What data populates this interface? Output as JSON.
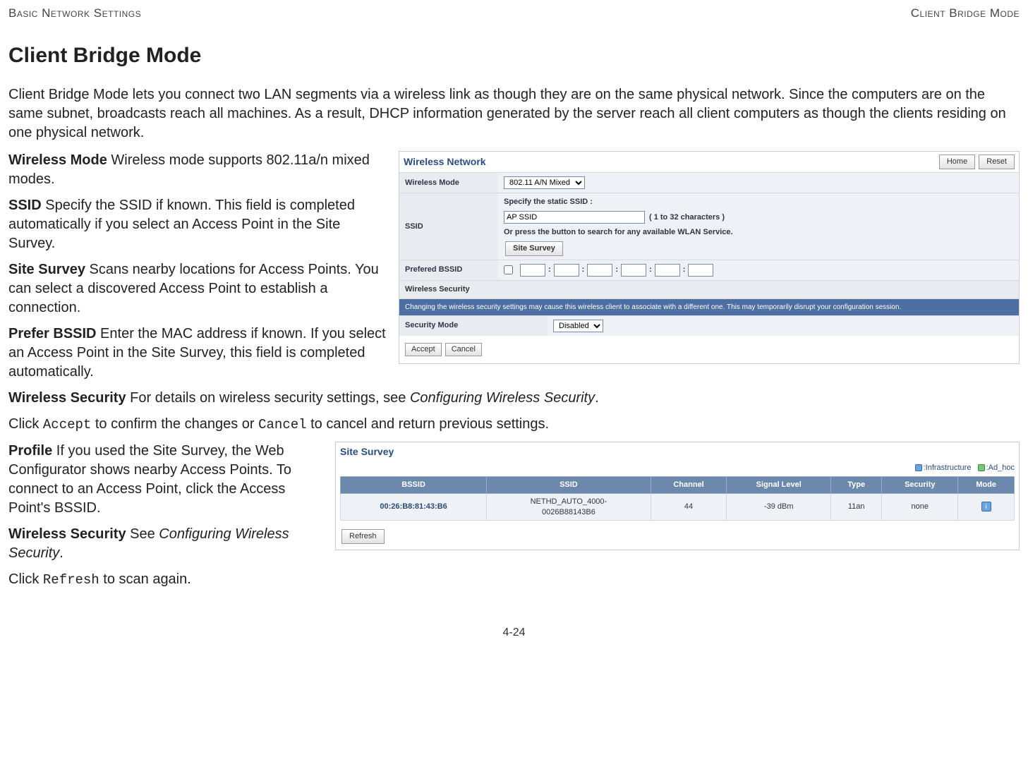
{
  "header": {
    "left": "Basic Network Settings",
    "right": "Client Bridge Mode"
  },
  "title": "Client Bridge Mode",
  "intro": "Client Bridge Mode lets you connect two LAN segments via a wireless link as though they are on the same physical network. Since the computers are on the same subnet, broadcasts reach all machines. As a result, DHCP information generated by the server reach all client computers as though the clients residing on one physical network.",
  "defs": {
    "wmode": {
      "label": "Wireless Mode",
      "text": "  Wireless mode supports 802.11a/n mixed modes."
    },
    "ssid": {
      "label": "SSID",
      "text": "  Specify the SSID if known. This field is completed automatically if you select an Access Point in the Site Survey."
    },
    "survey": {
      "label": "Site Survey",
      "text": "  Scans nearby locations for Access Points. You can select a discovered Access Point to establish a connection."
    },
    "bssid": {
      "label": "Prefer BSSID",
      "text": "  Enter the MAC address if known. If you select an Access Point in the Site Survey, this field is completed automatically."
    },
    "wsec": {
      "label": "Wireless Security",
      "text": "  For details on wireless security settings, see ",
      "link": "Configuring Wireless Security",
      "tail": "."
    }
  },
  "confirm": {
    "pre": "Click ",
    "accept": "Accept",
    "mid": " to confirm the changes or ",
    "cancel": "Cancel",
    "post": " to cancel and return previous settings."
  },
  "defs2": {
    "profile": {
      "label": "Profile",
      "text": "  If you used the Site Survey, the Web Configurator shows nearby Access Points. To connect to an Access Point, click the Access Point's BSSID."
    },
    "wsec2": {
      "label": "Wireless Security",
      "text": "  See ",
      "link": "Configuring Wireless Security",
      "tail": "."
    }
  },
  "refresh_line": {
    "pre": "Click ",
    "cmd": "Refresh",
    "post": " to scan again."
  },
  "wn": {
    "title": "Wireless Network",
    "home": "Home",
    "reset": "Reset",
    "mode_label": "Wireless Mode",
    "mode_value": "802.11 A/N Mixed",
    "ssid_label": "SSID",
    "ssid_line1": "Specify the static SSID  :",
    "ssid_value": "AP SSID",
    "ssid_hint": "( 1 to 32 characters )",
    "ssid_line2": "Or press the button to search for any available WLAN Service.",
    "site_survey_btn": "Site Survey",
    "bssid_label": "Prefered BSSID",
    "sec_header": "Wireless Security",
    "sec_banner": "Changing the wireless security settings may cause this wireless client to associate with a different one. This may temporarily disrupt your configuration session.",
    "sec_mode_label": "Security Mode",
    "sec_mode_value": "Disabled",
    "accept": "Accept",
    "cancel": "Cancel",
    "colon": ":"
  },
  "ss": {
    "title": "Site Survey",
    "legend_infra": ":Infrastructure",
    "legend_adhoc": ":Ad_hoc",
    "cols": {
      "bssid": "BSSID",
      "ssid": "SSID",
      "channel": "Channel",
      "signal": "Signal Level",
      "type": "Type",
      "security": "Security",
      "mode": "Mode"
    },
    "row": {
      "bssid": "00:26:B8:81:43:B6",
      "ssid_line1": "NETHD_AUTO_4000-",
      "ssid_line2": "0026B88143B6",
      "channel": "44",
      "signal": "-39 dBm",
      "type": "11an",
      "security": "none",
      "mode": "i"
    },
    "refresh": "Refresh"
  },
  "page_num": "4-24"
}
